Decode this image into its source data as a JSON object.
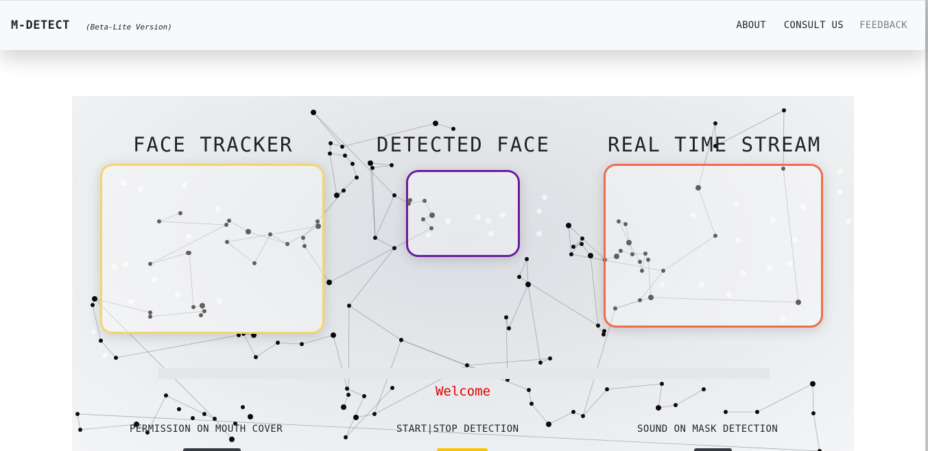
{
  "navbar": {
    "brand": "M-DETECT",
    "brand_sub": "(Beta-Lite Version)",
    "links": [
      "ABOUT",
      "CONSULT US",
      "FEEDBACK"
    ]
  },
  "hero": {
    "titles": {
      "face_tracker": "FACE TRACKER",
      "detected_face": "DETECTED FACE",
      "real_time_stream": "REAL TIME STREAM"
    },
    "welcome": "Welcome",
    "controls": {
      "mouth_cover": "PERMISSION ON MOUTH COVER",
      "start_stop": "START|STOP DETECTION",
      "sound": "SOUND ON MASK DETECTION"
    }
  },
  "colors": {
    "face_tracker_frame": "#f7d46a",
    "detected_face_frame": "#6a1b9a",
    "real_time_stream_frame": "#ee6b4d",
    "welcome_text": "#e00000",
    "start_stop_button": "#f7c600",
    "toggle_buttons": "#343a40"
  }
}
